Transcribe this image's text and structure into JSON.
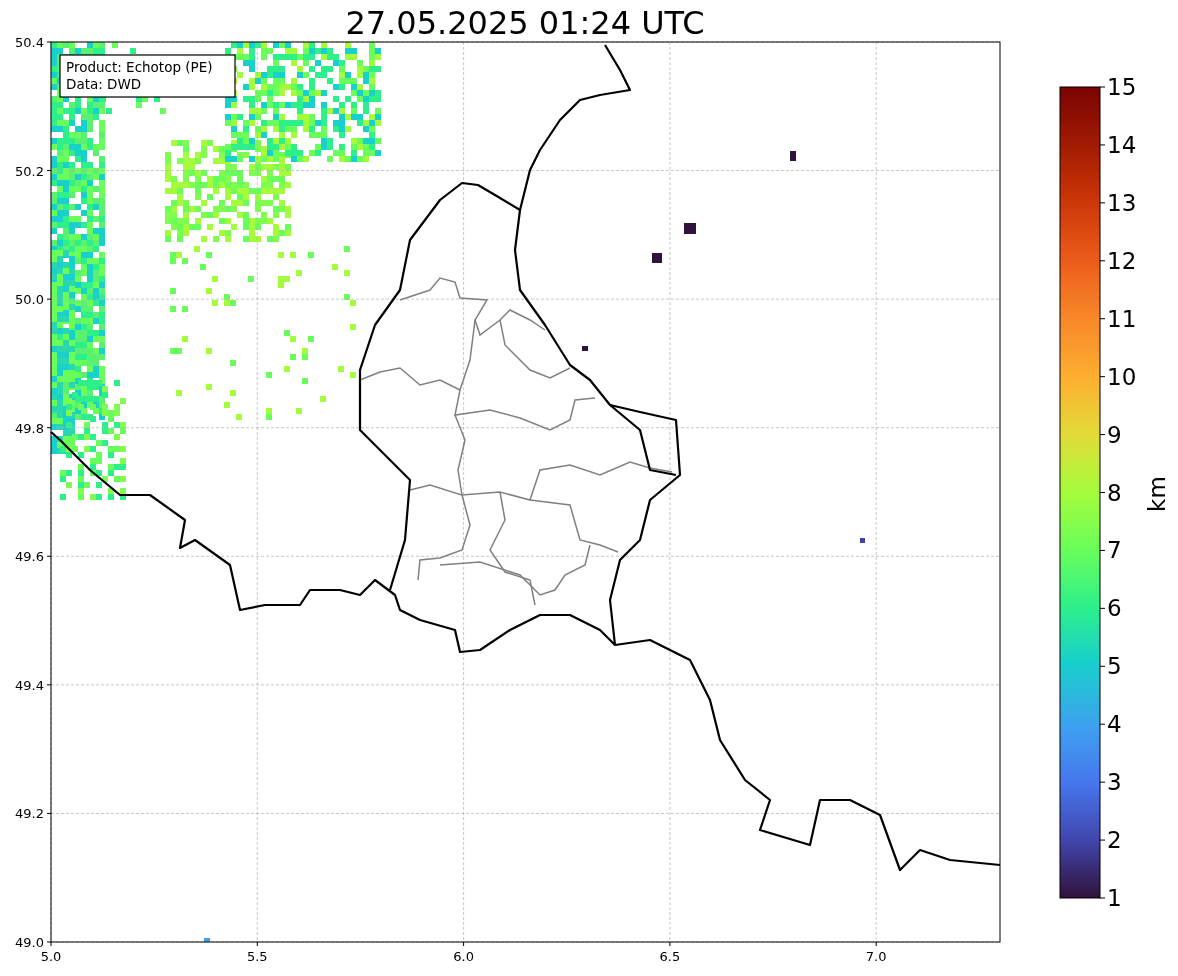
{
  "title": "27.05.2025 01:24 UTC",
  "info_box": {
    "lines": [
      "Product: Echotop (PE)",
      "Data: DWD"
    ]
  },
  "x_axis": {
    "ticks": [
      "5.0",
      "5.5",
      "6.0",
      "6.5",
      "7.0"
    ]
  },
  "y_axis": {
    "ticks": [
      "50.4",
      "50.2",
      "50.0",
      "49.8",
      "49.6",
      "49.4",
      "49.2",
      "49.0"
    ]
  },
  "colorbar": {
    "label": "km",
    "ticks": [
      "15",
      "14",
      "13",
      "12",
      "11",
      "10",
      "9",
      "8",
      "7",
      "6",
      "5",
      "4",
      "3",
      "2",
      "1"
    ]
  }
}
